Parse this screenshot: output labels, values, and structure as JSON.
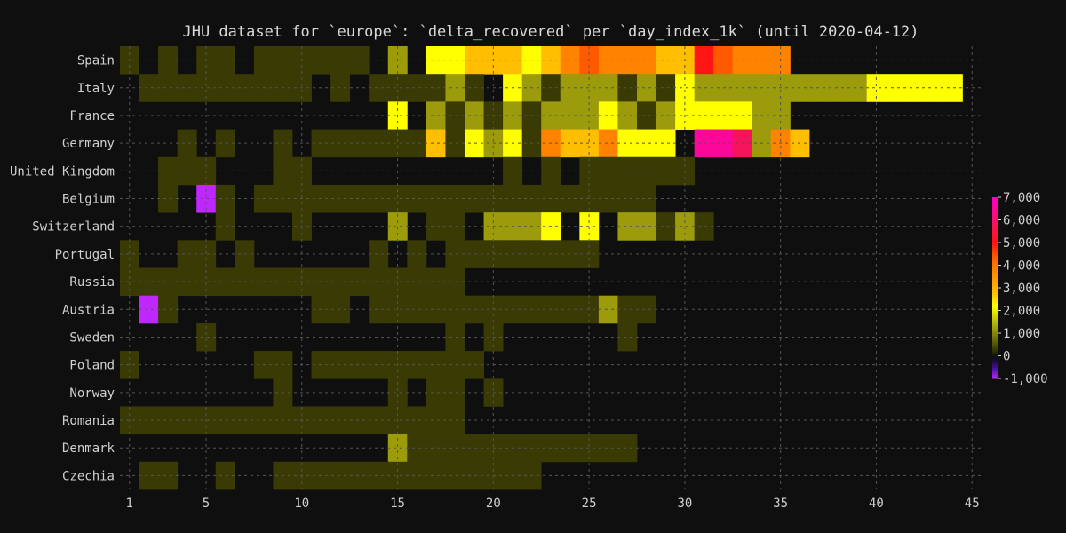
{
  "chart_data": {
    "type": "heatmap",
    "title": "JHU dataset for `europe`: `delta_recovered` per `day_index_1k` (until 2020-04-12)",
    "xlabel": "",
    "ylabel": "",
    "x_range": [
      1,
      45
    ],
    "x_ticks": [
      1,
      5,
      10,
      15,
      20,
      25,
      30,
      35,
      40,
      45
    ],
    "grid": true,
    "countries": [
      "Spain",
      "Italy",
      "France",
      "Germany",
      "United Kingdom",
      "Belgium",
      "Switzerland",
      "Portugal",
      "Russia",
      "Austria",
      "Sweden",
      "Poland",
      "Norway",
      "Romania",
      "Denmark",
      "Czechia"
    ],
    "values": {
      "Spain": [
        300,
        0,
        300,
        0,
        300,
        300,
        0,
        300,
        300,
        300,
        300,
        300,
        300,
        0,
        1200,
        0,
        2200,
        2200,
        2800,
        2800,
        2800,
        2200,
        2800,
        3800,
        4400,
        3800,
        3800,
        3800,
        2800,
        2800,
        5000,
        4400,
        3800,
        3800,
        3800
      ],
      "Italy": [
        0,
        300,
        300,
        300,
        300,
        300,
        300,
        300,
        300,
        300,
        0,
        300,
        0,
        300,
        300,
        300,
        300,
        1200,
        300,
        0,
        2200,
        1200,
        300,
        1200,
        1200,
        1200,
        300,
        1200,
        300,
        2200,
        1200,
        1200,
        1200,
        1200,
        1200,
        1200,
        1200,
        1200,
        1200,
        2200,
        2200,
        2200,
        2200,
        2200
      ],
      "France": [
        0,
        0,
        0,
        0,
        0,
        0,
        0,
        0,
        0,
        0,
        0,
        0,
        0,
        0,
        2200,
        0,
        1200,
        300,
        1200,
        300,
        1200,
        300,
        1200,
        1200,
        1200,
        2200,
        1200,
        300,
        1200,
        2200,
        2200,
        2200,
        2200,
        1200,
        1200
      ],
      "Germany": [
        0,
        0,
        0,
        300,
        0,
        300,
        0,
        0,
        300,
        0,
        300,
        300,
        300,
        300,
        300,
        300,
        2800,
        300,
        2200,
        1200,
        2200,
        300,
        3800,
        2800,
        2800,
        3800,
        2200,
        2200,
        2200,
        0,
        6500,
        6500,
        5800,
        1200,
        3800,
        2800
      ],
      "United Kingdom": [
        0,
        0,
        300,
        300,
        300,
        0,
        0,
        0,
        300,
        300,
        0,
        0,
        0,
        0,
        0,
        0,
        0,
        0,
        0,
        0,
        300,
        0,
        300,
        0,
        300,
        300,
        300,
        300,
        300,
        300
      ],
      "Belgium": [
        0,
        0,
        300,
        0,
        -1000,
        300,
        0,
        300,
        300,
        300,
        300,
        300,
        300,
        300,
        300,
        300,
        300,
        300,
        300,
        300,
        300,
        300,
        300,
        300,
        300,
        300,
        300,
        300
      ],
      "Switzerland": [
        0,
        0,
        0,
        0,
        0,
        300,
        0,
        0,
        0,
        300,
        0,
        0,
        0,
        0,
        1200,
        0,
        300,
        300,
        0,
        1200,
        1200,
        1200,
        2200,
        0,
        2200,
        0,
        1200,
        1200,
        300,
        1200,
        300
      ],
      "Portugal": [
        300,
        0,
        0,
        300,
        300,
        0,
        300,
        0,
        0,
        0,
        0,
        0,
        0,
        300,
        0,
        300,
        0,
        300,
        300,
        300,
        300,
        300,
        300,
        300,
        300
      ],
      "Russia": [
        300,
        300,
        300,
        300,
        300,
        300,
        300,
        300,
        300,
        300,
        300,
        300,
        300,
        300,
        300,
        300,
        300,
        300
      ],
      "Austria": [
        0,
        -1000,
        300,
        0,
        0,
        0,
        0,
        0,
        0,
        0,
        300,
        300,
        0,
        300,
        300,
        300,
        300,
        300,
        300,
        300,
        300,
        300,
        300,
        300,
        300,
        1200,
        300,
        300
      ],
      "Sweden": [
        0,
        0,
        0,
        0,
        300,
        0,
        0,
        0,
        0,
        0,
        0,
        0,
        0,
        0,
        0,
        0,
        0,
        300,
        0,
        300,
        0,
        0,
        0,
        0,
        0,
        0,
        300
      ],
      "Poland": [
        300,
        0,
        0,
        0,
        0,
        0,
        0,
        300,
        300,
        0,
        300,
        300,
        300,
        300,
        300,
        300,
        300,
        300,
        300
      ],
      "Norway": [
        0,
        0,
        0,
        0,
        0,
        0,
        0,
        0,
        300,
        0,
        0,
        0,
        0,
        0,
        300,
        0,
        300,
        300,
        0,
        300
      ],
      "Romania": [
        300,
        300,
        300,
        300,
        300,
        300,
        300,
        300,
        300,
        300,
        300,
        300,
        300,
        300,
        300,
        300,
        300,
        300
      ],
      "Denmark": [
        0,
        0,
        0,
        0,
        0,
        0,
        0,
        0,
        0,
        0,
        0,
        0,
        0,
        0,
        1200,
        300,
        300,
        300,
        300,
        300,
        300,
        300,
        300,
        300,
        300,
        300,
        300
      ],
      "Czechia": [
        0,
        300,
        300,
        0,
        0,
        300,
        0,
        0,
        300,
        300,
        300,
        300,
        300,
        300,
        300,
        300,
        300,
        300,
        300,
        300,
        300,
        300
      ]
    },
    "colorbar": {
      "min": -1000,
      "max": 7000,
      "ticks": [
        7000,
        6000,
        5000,
        4000,
        3000,
        2000,
        1000,
        0,
        -1000
      ],
      "tick_labels": [
        "7,000",
        "6,000",
        "5,000",
        "4,000",
        "3,000",
        "2,000",
        "1,000",
        "0",
        "-1,000"
      ]
    }
  },
  "colors": {
    "background": "#0f0f0f",
    "no_data": "#0f0f0f",
    "text": "#d0d0d0",
    "grid": "#555555"
  }
}
